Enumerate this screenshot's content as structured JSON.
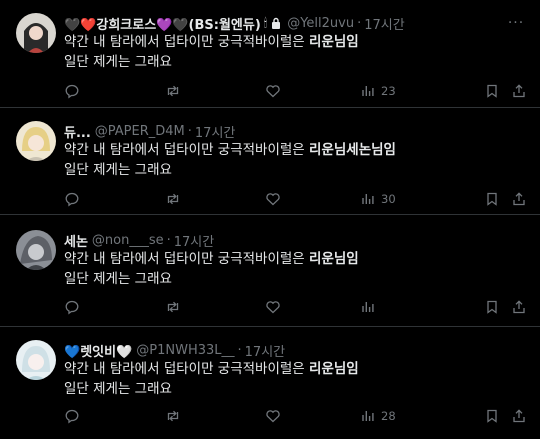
{
  "tweets": [
    {
      "name_prefix": "🖤❤️",
      "name": "강희크로스",
      "name_suffix": "💜🖤(BS:월엔듀)",
      "handle": "@Yell2uvu",
      "time": "17시간",
      "line1_pre": "약간 내 탐라에서 덥타이만 궁극적바이럴은 ",
      "line1_bold": "리운님임",
      "line2": "일단 제게는 그래요",
      "views": "23"
    },
    {
      "name": "듀...",
      "handle": "@PAPER_D4M",
      "time": "17시간",
      "line1_pre": "약간 내 탐라에서 덥타이만 궁극적바이럴은 ",
      "line1_bold": "리운님세논님임",
      "line2": "일단 제게는 그래요",
      "views": "30"
    },
    {
      "name": "세논",
      "handle": "@non___se",
      "time": "17시간",
      "line1_pre": "약간 내 탐라에서 덥타이만 궁극적바이럴은 ",
      "line1_bold": "리운님임",
      "line2": "일단 제게는 그래요",
      "views": ""
    },
    {
      "name_prefix": "💙",
      "name": "렛잇비",
      "name_suffix": "🤍",
      "handle": "@P1NWH33L__",
      "time": "17시간",
      "line1_pre": "약간 내 탐라에서 덥타이만 궁극적바이럴은 ",
      "line1_bold": "리운님임",
      "line2": "일단 제게는 그래요",
      "views": "28"
    }
  ],
  "more_label": "···",
  "colors": {
    "background": "#000000",
    "text": "#e7e9ea",
    "muted": "#71767b",
    "divider": "#2f3336"
  }
}
